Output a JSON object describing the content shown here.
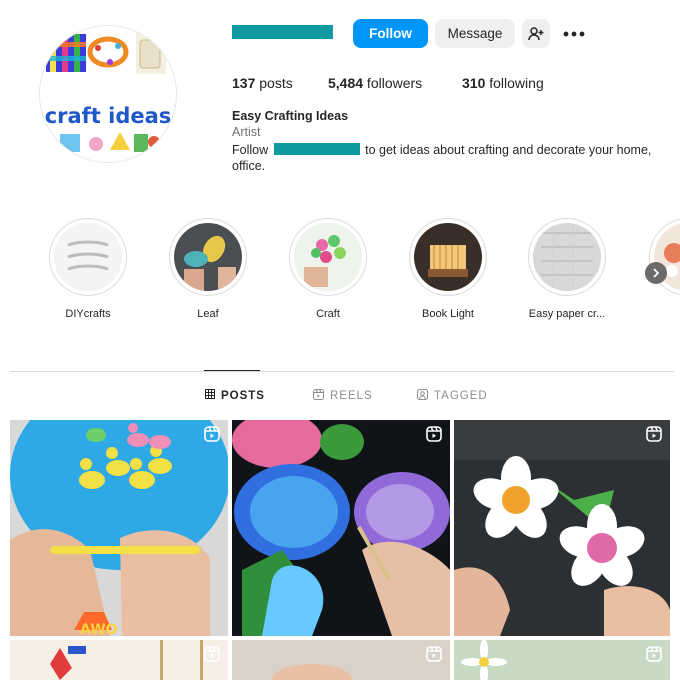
{
  "profile": {
    "follow_label": "Follow",
    "message_label": "Message",
    "avatar_text": "craft ideas",
    "stats": {
      "posts_count": "137",
      "posts_label": " posts",
      "followers_count": "5,484",
      "followers_label": " followers",
      "following_count": "310",
      "following_label": " following"
    },
    "bio": {
      "name": "Easy Crafting Ideas",
      "category": "Artist",
      "text_before": "Follow",
      "text_after": "to get ideas about crafting and decorate your home, office."
    }
  },
  "highlights": [
    {
      "label": "DIYcrafts"
    },
    {
      "label": "Leaf"
    },
    {
      "label": "Craft"
    },
    {
      "label": "Book Light"
    },
    {
      "label": "Easy paper cr..."
    }
  ],
  "tabs": [
    {
      "label": "POSTS",
      "active": true
    },
    {
      "label": "REELS",
      "active": false
    },
    {
      "label": "TAGGED",
      "active": false
    }
  ],
  "colors": {
    "accent": "#0095f6",
    "redaction": "#0f9aa0",
    "border": "#dbdbdb",
    "muted_text": "#737373"
  },
  "icons": {
    "add_user": "add-user-icon",
    "more": "more-options-icon",
    "posts_tab": "grid-icon",
    "reels_tab": "reels-icon",
    "tagged_tab": "tagged-icon",
    "reel_badge": "reel-icon",
    "next": "chevron-right-icon"
  }
}
